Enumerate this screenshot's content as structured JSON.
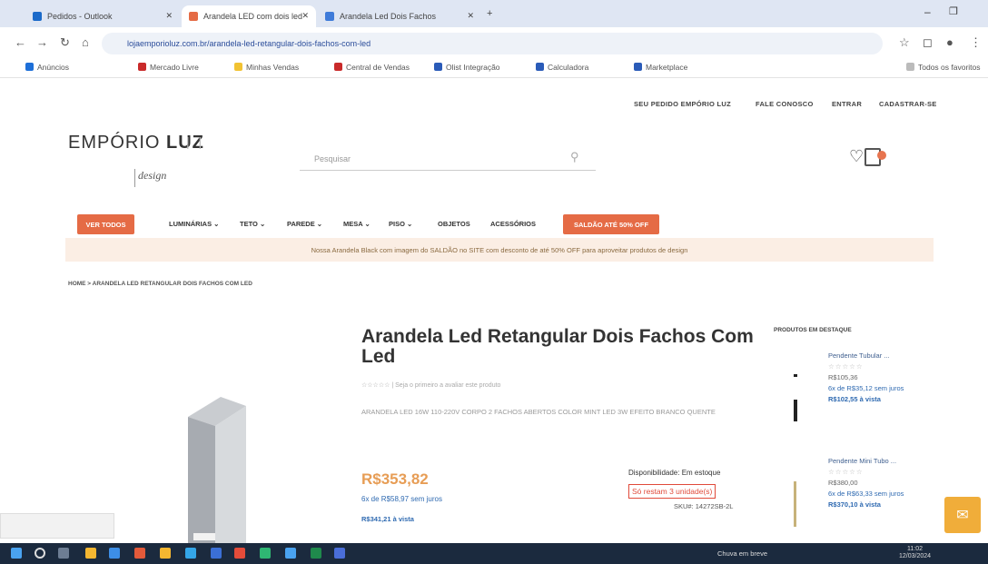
{
  "browser": {
    "tabs": [
      {
        "title": "Pedidos - Outlook"
      },
      {
        "title": "Arandela LED com dois led"
      },
      {
        "title": "Arandela Led Dois Fachos"
      }
    ],
    "url": "lojaemporioluz.com.br/arandela-led-retangular-dois-fachos-com-led",
    "bookmarks": [
      "Anúncios",
      "Mercado Livre",
      "Minhas Vendas",
      "Central de Vendas",
      "Olist Integração",
      "Calculadora",
      "Marketplace",
      "Todos os favoritos"
    ]
  },
  "site": {
    "toplinks": [
      "SEU PEDIDO EMPÓRIO LUZ",
      "FALE CONOSCO",
      "ENTRAR",
      "CADASTRAR-SE"
    ],
    "logo_main": "EMPÓRIO",
    "logo_bold": "LUZ",
    "logo_bars": "| |",
    "logo_sub": "design",
    "search_placeholder": "Pesquisar",
    "nav": {
      "pill_left": "VER TODOS",
      "items": [
        "LUMINÁRIAS ⌄",
        "TETO ⌄",
        "PAREDE ⌄",
        "MESA ⌄",
        "PISO ⌄",
        "OBJETOS",
        "ACESSÓRIOS"
      ],
      "pill_right": "SALDÃO ATÉ 50% OFF"
    },
    "promo": "Nossa Arandela Black com imagem do SALDÃO no SITE com desconto de até 50% OFF para aproveitar produtos de design",
    "breadcrumb": "HOME  >  ARANDELA LED RETANGULAR DOIS FACHOS COM LED"
  },
  "product": {
    "title": "Arandela Led Retangular Dois Fachos Com Led",
    "rating": "☆☆☆☆☆  |  Seja o primeiro a avaliar este produto",
    "desc": "ARANDELA LED 16W 110-220V CORPO 2 FACHOS ABERTOS COLOR MINT LED 3W EFEITO BRANCO QUENTE",
    "price": "R$353,82",
    "installment": "6x  de R$58,97 sem juros",
    "pix": "R$341,21 à vista",
    "availability": "Disponibilidade: Em estoque",
    "stock": "Só restam 3 unidade(s)",
    "sku": "SKU#: 14272SB-2L"
  },
  "related": {
    "title": "PRODUTOS EM DESTAQUE",
    "items": [
      {
        "name": "Pendente Tubular ...",
        "stars": "☆☆☆☆☆",
        "price": "R$105,36",
        "install": "6x de R$35,12 sem juros",
        "pix": "R$102,55 à vista"
      },
      {
        "name": "Pendente Mini Tubo ...",
        "stars": "☆☆☆☆☆",
        "price": "R$380,00",
        "install": "6x de R$63,33 sem juros",
        "pix": "R$370,10 à vista"
      }
    ]
  },
  "taskbar": {
    "weather": "Chuva em breve",
    "time": "11:02",
    "date": "12/03/2024"
  },
  "colors": {
    "accent": "#e56b45",
    "price": "#e79d55",
    "link": "#2f6ab1",
    "stock": "#e04a3a"
  }
}
